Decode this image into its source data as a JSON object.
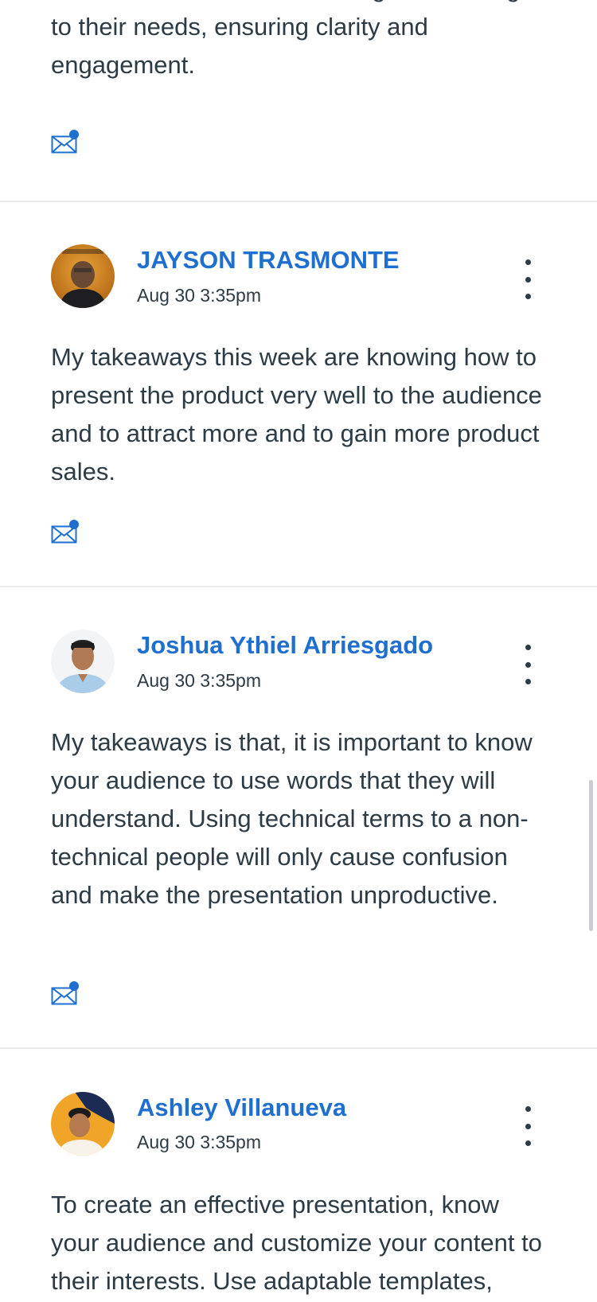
{
  "colors": {
    "author_link": "#1f6fd0",
    "body_text": "#2d3b45",
    "divider": "#e8eaec",
    "unread_dot": "#1f6fd0"
  },
  "partial_post": {
    "body": "crucial, as it allows for tailoring the message to their needs, ensuring clarity and engagement.",
    "mail_icon": "mail-unread-icon"
  },
  "posts": [
    {
      "author": "JAYSON TRASMONTE",
      "date": "Aug 30 3:35pm",
      "body": "My takeaways this week are knowing how to present the product very well to the audience and to  attract more  and to gain more product sales.",
      "avatar": "avatar-photo",
      "menu_icon": "more-options-icon",
      "mail_icon": "mail-unread-icon"
    },
    {
      "author": "Joshua Ythiel Arriesgado",
      "date": "Aug 30 3:35pm",
      "body": "My takeaways is that, it is important to know your audience to use words that they will understand. Using technical terms to a non-technical people will only cause confusion and make the presentation unproductive.",
      "avatar": "avatar-photo",
      "menu_icon": "more-options-icon",
      "mail_icon": "mail-unread-icon"
    },
    {
      "author": "Ashley Villanueva",
      "date": "Aug 30 3:35pm",
      "body": "To create an effective presentation, know your audience and customize your content to their interests. Use adaptable templates,",
      "avatar": "avatar-photo",
      "menu_icon": "more-options-icon"
    }
  ]
}
